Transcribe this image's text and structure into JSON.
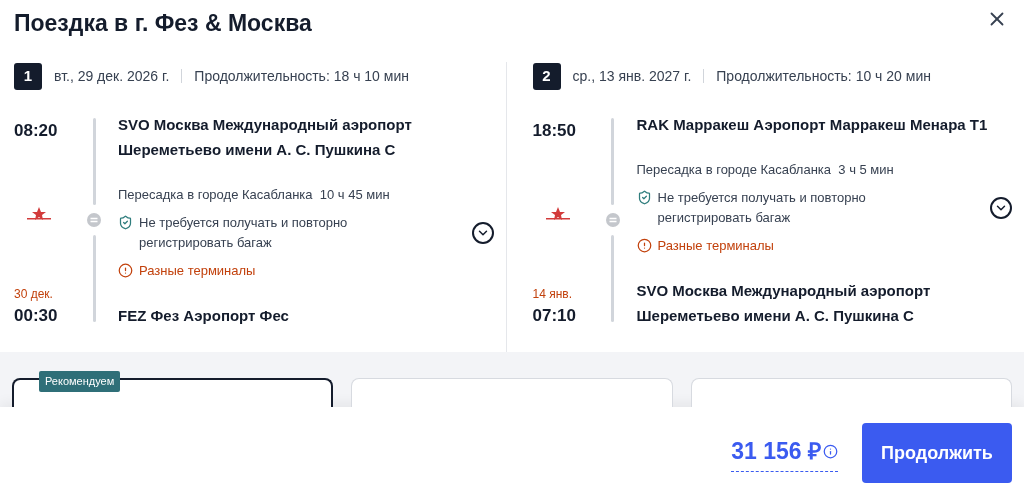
{
  "title": "Поездка в г. Фез & Москва",
  "legs": [
    {
      "number": "1",
      "date": "вт., 29 дек. 2026 г.",
      "duration": "Продолжительность: 18 ч 10 мин",
      "departure": {
        "time": "08:20",
        "airport": "SVO Москва Международный аэропорт Шереметьево имени А. С. Пушкина C"
      },
      "transfer": {
        "city": "Пересадка в городе Касабланка",
        "duration": "10 ч 45 мин",
        "baggage_note": "Не требуется получать и повторно регистрировать багаж",
        "warning": "Разные терминалы"
      },
      "arrival": {
        "date": "30 дек.",
        "time": "00:30",
        "airport": "FEZ Фез Аэропорт Фес"
      }
    },
    {
      "number": "2",
      "date": "ср., 13 янв. 2027 г.",
      "duration": "Продолжительность: 10 ч 20 мин",
      "departure": {
        "time": "18:50",
        "airport": "RAK Марракеш Аэропорт Марракеш Менара T1"
      },
      "transfer": {
        "city": "Пересадка в городе Касабланка",
        "duration": "3 ч 5 мин",
        "baggage_note": "Не требуется получать и повторно регистрировать багаж",
        "warning": "Разные терминалы"
      },
      "arrival": {
        "date": "14 янв.",
        "time": "07:10",
        "airport": "SVO Москва Международный аэропорт Шереметьево имени А. С. Пушкина C"
      }
    }
  ],
  "fares": [
    {
      "badge": "Рекомендуем",
      "selected": true
    },
    {
      "selected": false
    },
    {
      "selected": false
    }
  ],
  "price": "31 156 ₽",
  "continue_button": "Продолжить"
}
